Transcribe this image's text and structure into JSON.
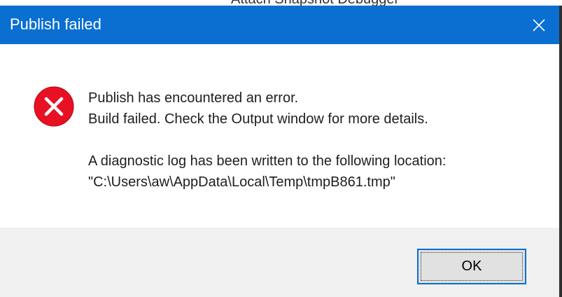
{
  "background_window": {
    "partial_title": "Attach Snapshot Debugger"
  },
  "dialog": {
    "title": "Publish failed",
    "close_icon": "close-icon",
    "icon": "error-icon",
    "message": {
      "line1": "Publish has encountered an error.",
      "line2": "Build failed. Check the Output window for more details.",
      "line3": "A diagnostic log has been written to the following location:",
      "line4": "\"C:\\Users\\aw\\AppData\\Local\\Temp\\tmpB861.tmp\""
    },
    "ok_label": "OK"
  },
  "colors": {
    "titlebar": "#0a6fd1",
    "error_red": "#e81123",
    "footer": "#f0f0f0",
    "button": "#e1e1e1"
  }
}
